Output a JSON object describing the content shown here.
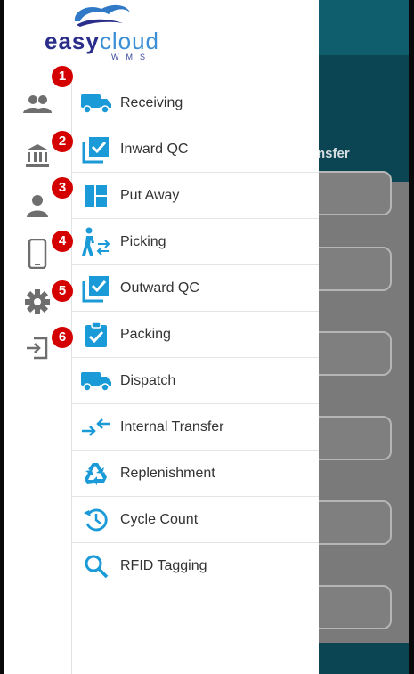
{
  "app": {
    "brand_word_1": "easy",
    "brand_word_2": "cloud",
    "brand_sub": "WMS"
  },
  "background": {
    "partial_tab_label": "nsfer"
  },
  "rail": [
    {
      "icon": "users-icon"
    },
    {
      "icon": "bank-icon"
    },
    {
      "icon": "person-icon"
    },
    {
      "icon": "mobile-icon"
    },
    {
      "icon": "gear-icon"
    },
    {
      "icon": "logout-icon"
    }
  ],
  "badges": [
    "1",
    "2",
    "3",
    "4",
    "5",
    "6"
  ],
  "menu": [
    {
      "label": "Receiving",
      "icon": "truck-icon"
    },
    {
      "label": "Inward QC",
      "icon": "checklist-icon"
    },
    {
      "label": "Put Away",
      "icon": "layout-icon"
    },
    {
      "label": "Picking",
      "icon": "person-walk-icon"
    },
    {
      "label": "Outward QC",
      "icon": "checklist-icon"
    },
    {
      "label": "Packing",
      "icon": "clipboard-check-icon"
    },
    {
      "label": "Dispatch",
      "icon": "truck-icon"
    },
    {
      "label": "Internal Transfer",
      "icon": "transfer-arrows-icon"
    },
    {
      "label": "Replenishment",
      "icon": "recycle-icon"
    },
    {
      "label": "Cycle Count",
      "icon": "history-icon"
    },
    {
      "label": "RFID Tagging",
      "icon": "search-icon"
    }
  ],
  "colors": {
    "accent": "#1a9ad6",
    "rail_icon": "#6e6e6e",
    "badge": "#d40000",
    "header": "#0f5e6e"
  }
}
